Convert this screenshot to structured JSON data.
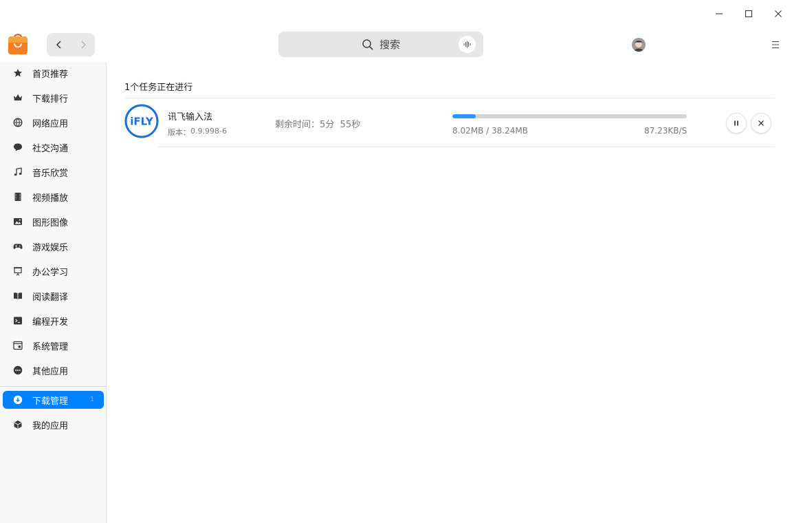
{
  "window": {
    "minimize_icon": "minimize-icon",
    "maximize_icon": "maximize-icon",
    "close_icon": "close-icon"
  },
  "header": {
    "search_placeholder": "搜索",
    "voice_icon": "voice-waveform-icon",
    "menu_icon": "hamburger-menu-icon"
  },
  "sidebar": {
    "categories": [
      {
        "label": "首页推荐",
        "icon": "star-icon"
      },
      {
        "label": "下载排行",
        "icon": "crown-icon"
      },
      {
        "label": "网络应用",
        "icon": "globe-icon"
      },
      {
        "label": "社交沟通",
        "icon": "chat-bubble-icon"
      },
      {
        "label": "音乐欣赏",
        "icon": "music-note-icon"
      },
      {
        "label": "视频播放",
        "icon": "film-icon"
      },
      {
        "label": "图形图像",
        "icon": "image-icon"
      },
      {
        "label": "游戏娱乐",
        "icon": "gamepad-icon"
      },
      {
        "label": "办公学习",
        "icon": "presentation-board-icon"
      },
      {
        "label": "阅读翻译",
        "icon": "book-icon"
      },
      {
        "label": "编程开发",
        "icon": "terminal-icon"
      },
      {
        "label": "系统管理",
        "icon": "system-window-icon"
      },
      {
        "label": "其他应用",
        "icon": "more-dots-icon"
      }
    ],
    "bottom": [
      {
        "label": "下载管理",
        "icon": "download-circle-icon",
        "badge": "1",
        "active": true
      },
      {
        "label": "我的应用",
        "icon": "cube-icon"
      }
    ]
  },
  "main": {
    "heading": "1个任务正在进行",
    "tasks": [
      {
        "icon_text": "iFLY",
        "name": "讯飞输入法",
        "version_label": "版本：",
        "version": "0.9.998-6",
        "remaining_label": "剩余时间：",
        "remaining": "5分  55秒",
        "downloaded": "8.02MB",
        "total": "38.24MB",
        "size_text": "8.02MB / 38.24MB",
        "speed": "87.23KB/S",
        "progress": 0.1,
        "pause_icon": "pause-icon",
        "cancel_icon": "close-icon"
      }
    ]
  },
  "colors": {
    "accent": "#0081ff",
    "progress": "#2d96ff",
    "ifly_blue": "#1e6fd9",
    "logo_orange": "#f26b1d"
  }
}
